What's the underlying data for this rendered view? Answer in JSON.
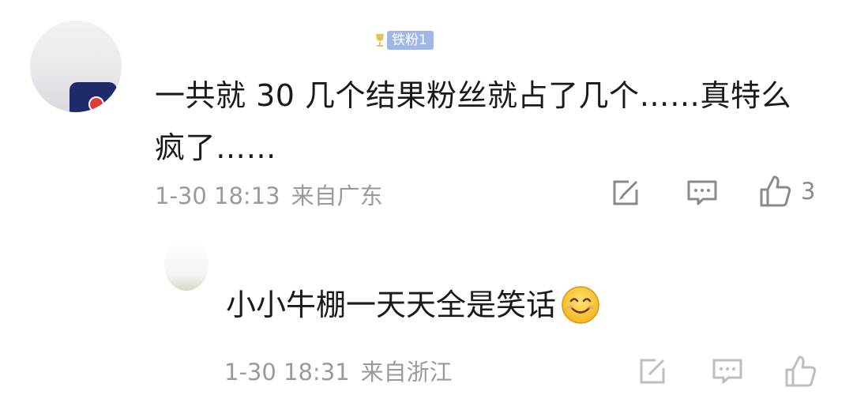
{
  "comments": [
    {
      "avatar": "user-avatar",
      "fan_badge": {
        "icon": "trophy-icon",
        "label": "铁粉1",
        "color": "#9fb7e6"
      },
      "text_line1": "一共就 30 几个结果粉丝就占了几个……真特么",
      "text_line2": "疯了……",
      "time": "1-30 18:13",
      "location": "来自广东",
      "actions": {
        "edit_icon": "edit-icon",
        "reply_icon": "comment-icon",
        "like_icon": "thumbs-up-icon",
        "like_count": "3"
      }
    },
    {
      "avatar": "user-avatar",
      "text": "小小牛棚一天天全是笑话",
      "emoji": "smile-emoji",
      "time": "1-30 18:31",
      "location": "来自浙江",
      "actions": {
        "edit_icon": "edit-icon",
        "reply_icon": "comment-icon",
        "like_icon": "thumbs-up-icon"
      }
    }
  ],
  "colors": {
    "text": "#1a1a1a",
    "meta": "#9a9a9a",
    "icon": "#8a8a8a"
  }
}
